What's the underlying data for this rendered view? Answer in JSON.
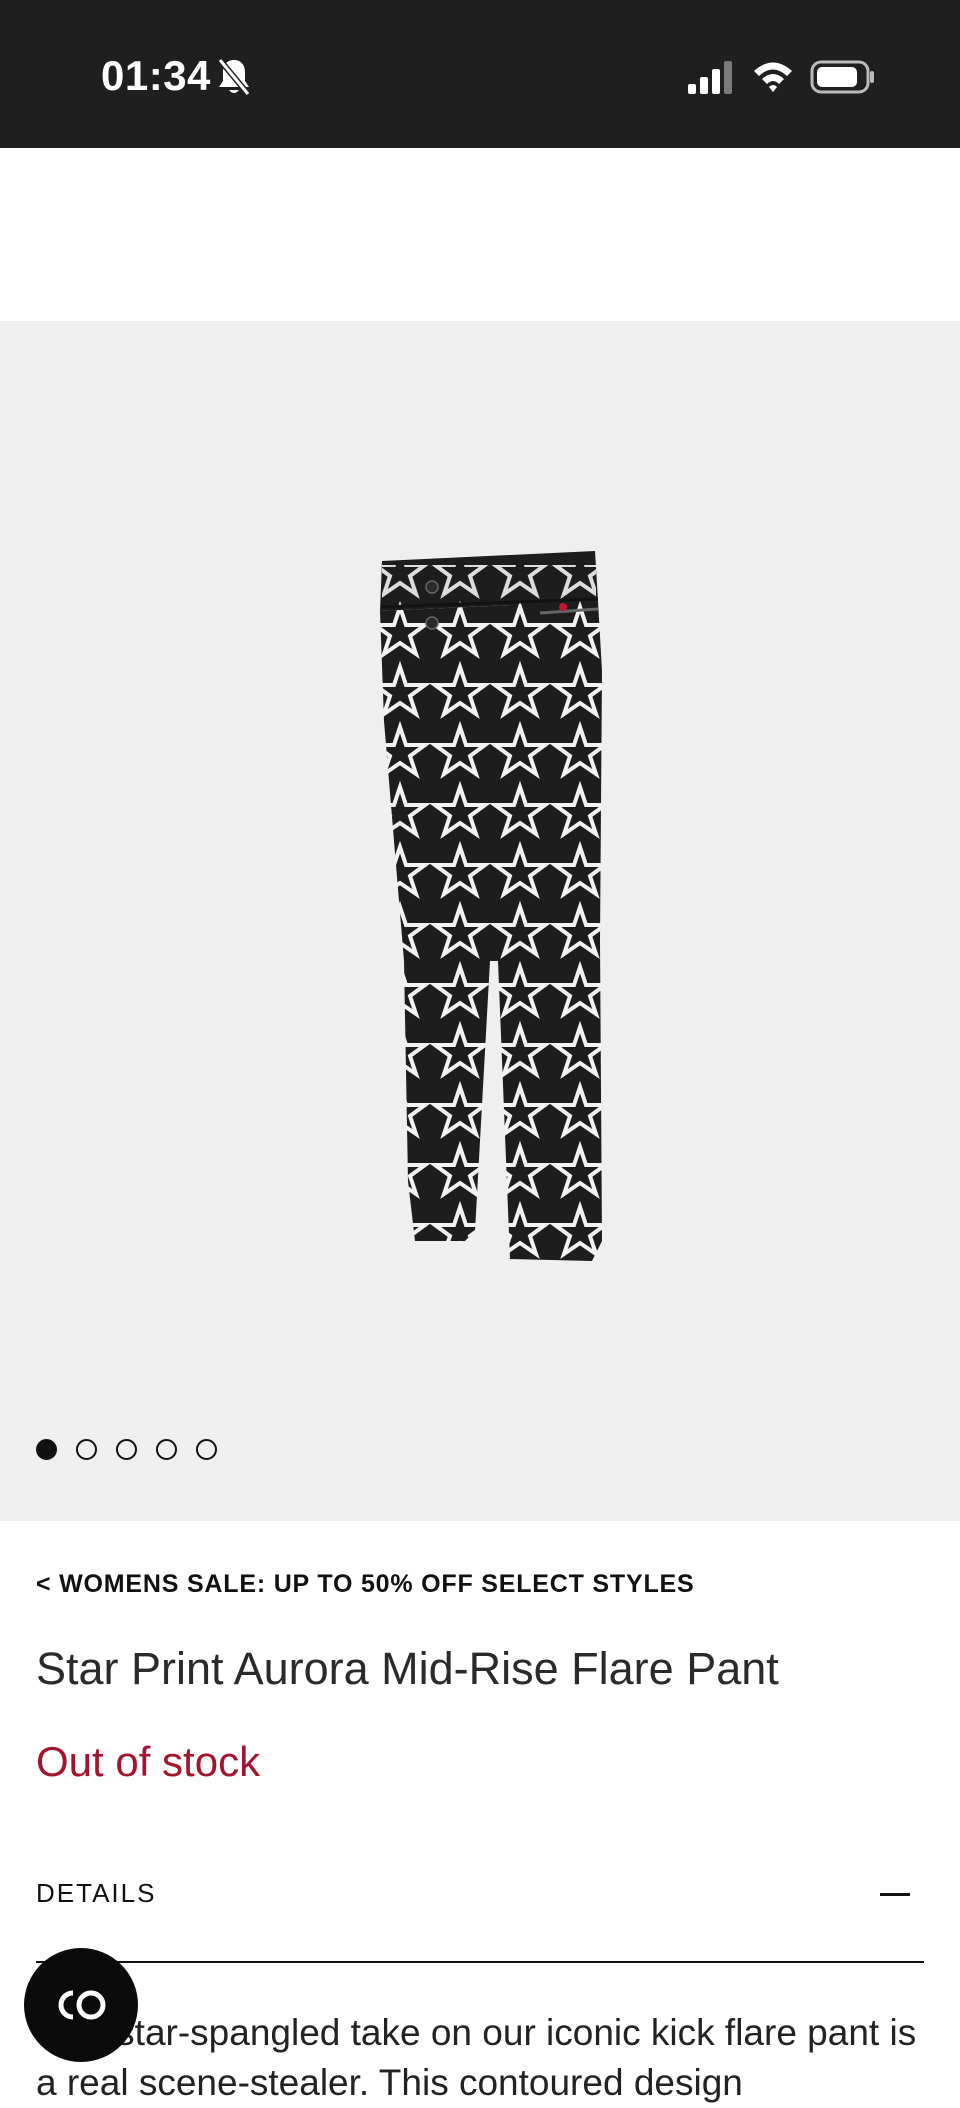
{
  "status_bar": {
    "time": "01:34",
    "bell_icon": "bell-slash-icon",
    "signal_icon": "cellular-signal-icon",
    "wifi_icon": "wifi-icon",
    "battery_icon": "battery-icon"
  },
  "gallery": {
    "image_icon": "star-print-pants-image",
    "dots_total": 5,
    "active_index": 0
  },
  "product": {
    "breadcrumb": "< WOMENS SALE: UP TO 50% OFF SELECT STYLES",
    "title": "Star Print Aurora Mid-Rise Flare Pant",
    "stock_status": "Out of stock",
    "stock_color": "#a3152f",
    "details_label": "DETAILS",
    "details_toggle_icon": "minus-icon",
    "description": "This star-spangled take on our iconic kick flare pant is a real scene-stealer. This contoured design"
  },
  "chat": {
    "icon": "chat-logo-icon"
  }
}
